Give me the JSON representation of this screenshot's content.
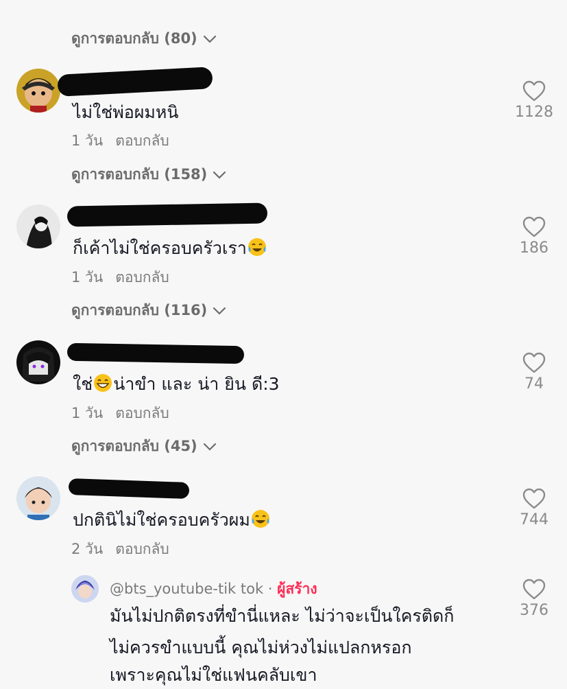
{
  "view_replies": [
    {
      "label": "ดูการตอบกลับ (80)"
    },
    {
      "label": "ดูการตอบกลับ (158)"
    },
    {
      "label": "ดูการตอบกลับ (116)"
    },
    {
      "label": "ดูการตอบกลับ (45)"
    }
  ],
  "comments": [
    {
      "text": "ไม่ใช่พ่อผมหนิ",
      "time": "1 วัน",
      "reply_label": "ตอบกลับ",
      "likes": "1128"
    },
    {
      "text": "ก็เค้าไม่ใช่ครอบครัวเรา",
      "time": "1 วัน",
      "reply_label": "ตอบกลับ",
      "likes": "186",
      "emoji": "tears-of-joy"
    },
    {
      "text_before": "ใช่",
      "text_after": "น่าขำ และ น่า ยิน ดี:3",
      "time": "1 วัน",
      "reply_label": "ตอบกลับ",
      "likes": "74",
      "emoji": "grinning"
    },
    {
      "text": "ปกตินิไม่ใช่ครอบครัวผม",
      "time": "2 วัน",
      "reply_label": "ตอบกลับ",
      "likes": "744",
      "emoji": "tears-of-joy"
    }
  ],
  "reply": {
    "author": "@bts_youtube-tik tok",
    "separator": "·",
    "badge": "ผู้สร้าง",
    "lines": [
      "มันไม่ปกติตรงที่ขำนี่แหละ ไม่ว่าจะเป็นใครติดก็",
      "ไม่ควรขำแบบนี้ คุณไม่ห่วงไม่แปลกหรอก",
      "เพราะคุณไม่ใช่แฟนคลับเขา"
    ],
    "likes": "376"
  },
  "colors": {
    "background": "#f7f7f7",
    "text": "#161823",
    "muted": "#7a7a7a",
    "creator_badge": "#fe2c55"
  }
}
